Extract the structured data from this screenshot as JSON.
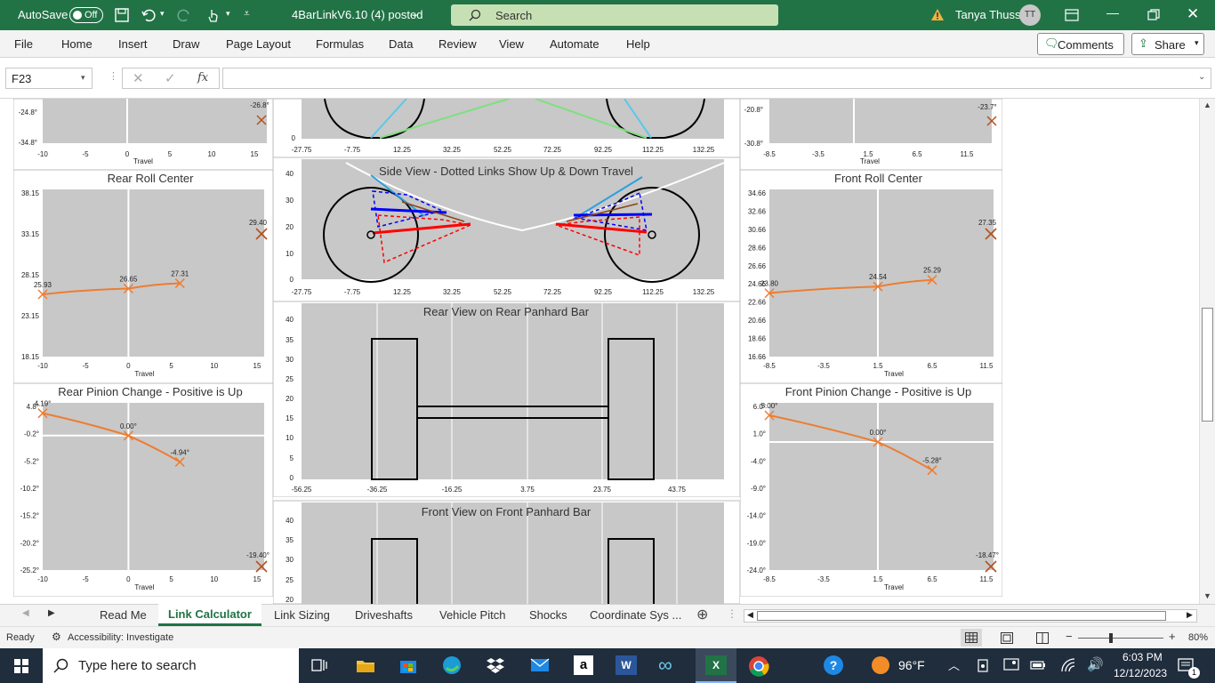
{
  "titlebar": {
    "autosave_label": "AutoSave",
    "autosave_state": "Off",
    "file_name": "4BarLinkV6.10 (4) posted",
    "search_placeholder": "Search",
    "user_name": "Tanya Thuss",
    "user_initials": "TT"
  },
  "ribbon": {
    "tabs": [
      "File",
      "Home",
      "Insert",
      "Draw",
      "Page Layout",
      "Formulas",
      "Data",
      "Review",
      "View",
      "Automate",
      "Help"
    ],
    "comments_label": "Comments",
    "share_label": "Share"
  },
  "formula_bar": {
    "name_box": "F23",
    "fx_label": "fx",
    "value": ""
  },
  "charts": {
    "top_left": {
      "yticks": [
        "-24.8°",
        "-34.8°"
      ],
      "xticks": [
        "-10",
        "-5",
        "0",
        "5",
        "10",
        "15"
      ],
      "xlabel": "Travel",
      "marker_label": "-26.8°"
    },
    "top_center": {
      "ytick": "0",
      "xticks": [
        "-27.75",
        "-7.75",
        "12.25",
        "32.25",
        "52.25",
        "72.25",
        "92.25",
        "112.25",
        "132.25"
      ]
    },
    "top_right": {
      "yticks": [
        "-20.8°",
        "-30.8°"
      ],
      "xticks": [
        "-8.5",
        "-3.5",
        "1.5",
        "6.5",
        "11.5"
      ],
      "xlabel": "Travel",
      "marker_label": "-23.7°"
    },
    "side_view": {
      "title": "Side View - Dotted Links Show Up & Down Travel",
      "yticks": [
        "40",
        "30",
        "20",
        "10",
        "0"
      ],
      "xticks": [
        "-27.75",
        "-7.75",
        "12.25",
        "32.25",
        "52.25",
        "72.25",
        "92.25",
        "112.25",
        "132.25"
      ]
    },
    "rear_roll": {
      "title": "Rear Roll Center",
      "yticks": [
        "38.15",
        "33.15",
        "28.15",
        "23.15",
        "18.15"
      ],
      "xticks": [
        "-10",
        "-5",
        "0",
        "5",
        "10",
        "15"
      ],
      "xlabel": "Travel",
      "point_labels": [
        "25.93",
        "26.65",
        "27.31"
      ],
      "marker_label": "29.40"
    },
    "front_roll": {
      "title": "Front Roll Center",
      "yticks": [
        "34.66",
        "32.66",
        "30.66",
        "28.66",
        "26.66",
        "24.66",
        "22.66",
        "20.66",
        "18.66",
        "16.66"
      ],
      "xticks": [
        "-8.5",
        "-3.5",
        "1.5",
        "6.5",
        "11.5"
      ],
      "xlabel": "Travel",
      "point_labels": [
        "23.80",
        "24.54",
        "25.29"
      ],
      "marker_label": "27.35"
    },
    "rear_panhard": {
      "title": "Rear View on Rear Panhard Bar",
      "yticks": [
        "40",
        "35",
        "30",
        "25",
        "20",
        "15",
        "10",
        "5",
        "0"
      ],
      "xticks": [
        "-56.25",
        "-36.25",
        "-16.25",
        "3.75",
        "23.75",
        "43.75"
      ]
    },
    "rear_pinion": {
      "title": "Rear Pinion Change - Positive is Up",
      "yticks": [
        "4.8°",
        "-0.2°",
        "-5.2°",
        "-10.2°",
        "-15.2°",
        "-20.2°",
        "-25.2°"
      ],
      "xticks": [
        "-10",
        "-5",
        "0",
        "5",
        "10",
        "15"
      ],
      "xlabel": "Travel",
      "point_labels": [
        "4.19°",
        "0.00°",
        "-4.94°"
      ],
      "marker_label": "-19.40°"
    },
    "front_pinion": {
      "title": "Front Pinion Change - Positive is Up",
      "yticks": [
        "6.0°",
        "1.0°",
        "-4.0°",
        "-9.0°",
        "-14.0°",
        "-19.0°",
        "-24.0°"
      ],
      "xticks": [
        "-8.5",
        "-3.5",
        "1.5",
        "6.5",
        "11.5"
      ],
      "xlabel": "Travel",
      "point_labels": [
        "5.00°",
        "0.00°",
        "-5.28°"
      ],
      "marker_label": "-18.47°"
    },
    "front_panhard": {
      "title": "Front View on Front Panhard Bar",
      "yticks": [
        "40",
        "35",
        "30",
        "25",
        "20"
      ]
    }
  },
  "sheet_tabs": {
    "tabs": [
      "Read Me",
      "Link Calculator",
      "Link Sizing",
      "Driveshafts",
      "Vehicle Pitch",
      "Shocks",
      "Coordinate Sys ..."
    ],
    "active": "Link Calculator"
  },
  "status": {
    "ready": "Ready",
    "accessibility": "Accessibility: Investigate",
    "zoom": "80%"
  },
  "taskbar": {
    "search_placeholder": "Type here to search",
    "weather": "96°F",
    "time": "6:03 PM",
    "date": "12/12/2023",
    "notification_count": "1"
  },
  "colors": {
    "excel_green": "#217346",
    "plot_bg": "#c8c8c8",
    "series_orange": "#ed7d31",
    "marker_brown": "#b4501e"
  },
  "chart_data": [
    {
      "type": "line",
      "title": "Rear Roll Center",
      "xlabel": "Travel",
      "x": [
        -10,
        0,
        6
      ],
      "values": [
        25.93,
        26.65,
        27.31
      ],
      "ylim": [
        18.15,
        38.15
      ],
      "xlim": [
        -10,
        15
      ]
    },
    {
      "type": "line",
      "title": "Front Roll Center",
      "xlabel": "Travel",
      "x": [
        -8.5,
        1.5,
        6.5
      ],
      "values": [
        23.8,
        24.54,
        25.29
      ],
      "ylim": [
        16.66,
        34.66
      ],
      "xlim": [
        -8.5,
        11.5
      ]
    },
    {
      "type": "line",
      "title": "Rear Pinion Change - Positive is Up",
      "xlabel": "Travel",
      "x": [
        -10,
        0,
        6
      ],
      "values": [
        4.19,
        0.0,
        -4.94
      ],
      "ylim": [
        -25.2,
        4.8
      ],
      "xlim": [
        -10,
        15
      ]
    },
    {
      "type": "line",
      "title": "Front Pinion Change - Positive is Up",
      "xlabel": "Travel",
      "x": [
        -8.5,
        1.5,
        6.5
      ],
      "values": [
        5.0,
        0.0,
        -5.28
      ],
      "ylim": [
        -24.0,
        6.0
      ],
      "xlim": [
        -8.5,
        11.5
      ]
    }
  ]
}
